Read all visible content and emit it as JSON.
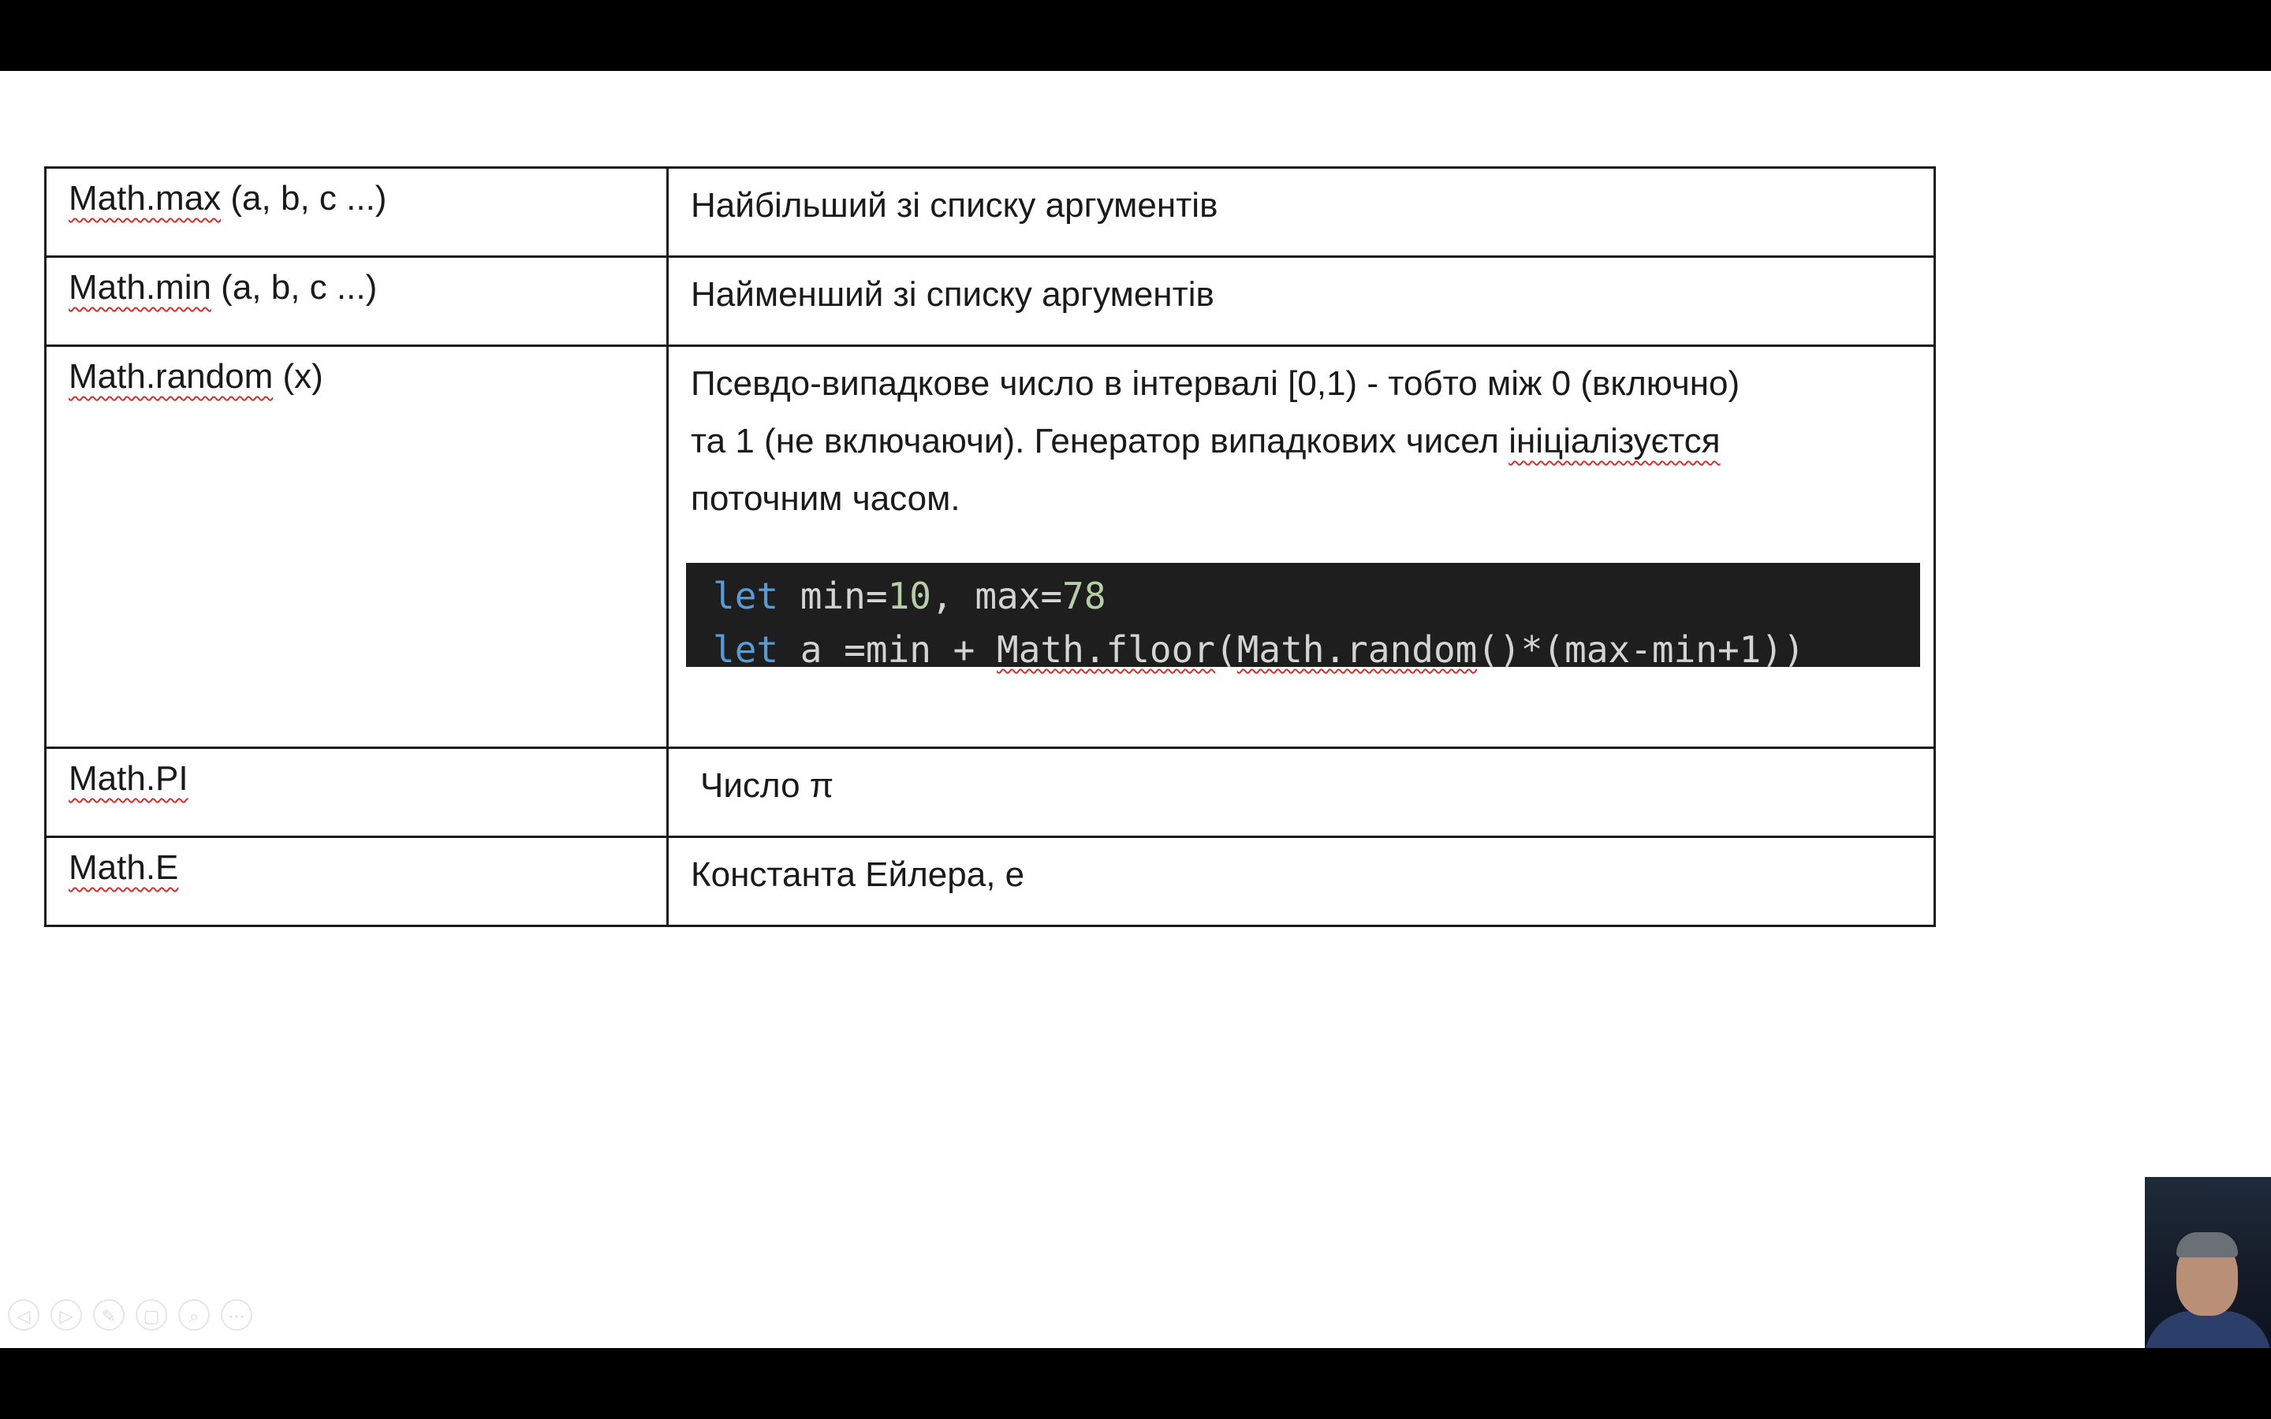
{
  "table": {
    "rows": [
      {
        "method": "Math.max",
        "args": " (a, b, c ...)",
        "description": "Найбільший зі списку аргументів"
      },
      {
        "method": "Math.min",
        "args": " (a, b, c ...)",
        "description": "Найменший зі списку аргументів"
      },
      {
        "method": "Math.random",
        "args": " (x)",
        "description_lines": [
          "Псевдо-випадкове число в інтервалі [0,1) - тобто між 0 (включно)",
          "та 1 (не включаючи). Генератор випадкових чисел ",
          "поточним часом."
        ],
        "description_underlined": "ініціалізуєтся",
        "code": {
          "line1": {
            "kw": "let",
            "a": " min=",
            "n1": "10",
            "b": ", max=",
            "n2": "78"
          },
          "line2": {
            "kw": "let",
            "a": " a =min + ",
            "fn1": "Math.floor",
            "b": "(",
            "fn2": "Math.random",
            "c": "()*(max-min+1))"
          }
        }
      },
      {
        "method": "Math.PI",
        "args": "",
        "description": "Число π"
      },
      {
        "method": "Math.E",
        "args": "",
        "description": "Константа Ейлера, e"
      }
    ]
  },
  "toolbar_icons": [
    "previous-icon",
    "next-icon",
    "pen-icon",
    "slides-icon",
    "zoom-icon",
    "more-icon"
  ],
  "toolbar_glyphs": [
    "◁",
    "▷",
    "✎",
    "▢",
    "⌕",
    "⋯"
  ]
}
